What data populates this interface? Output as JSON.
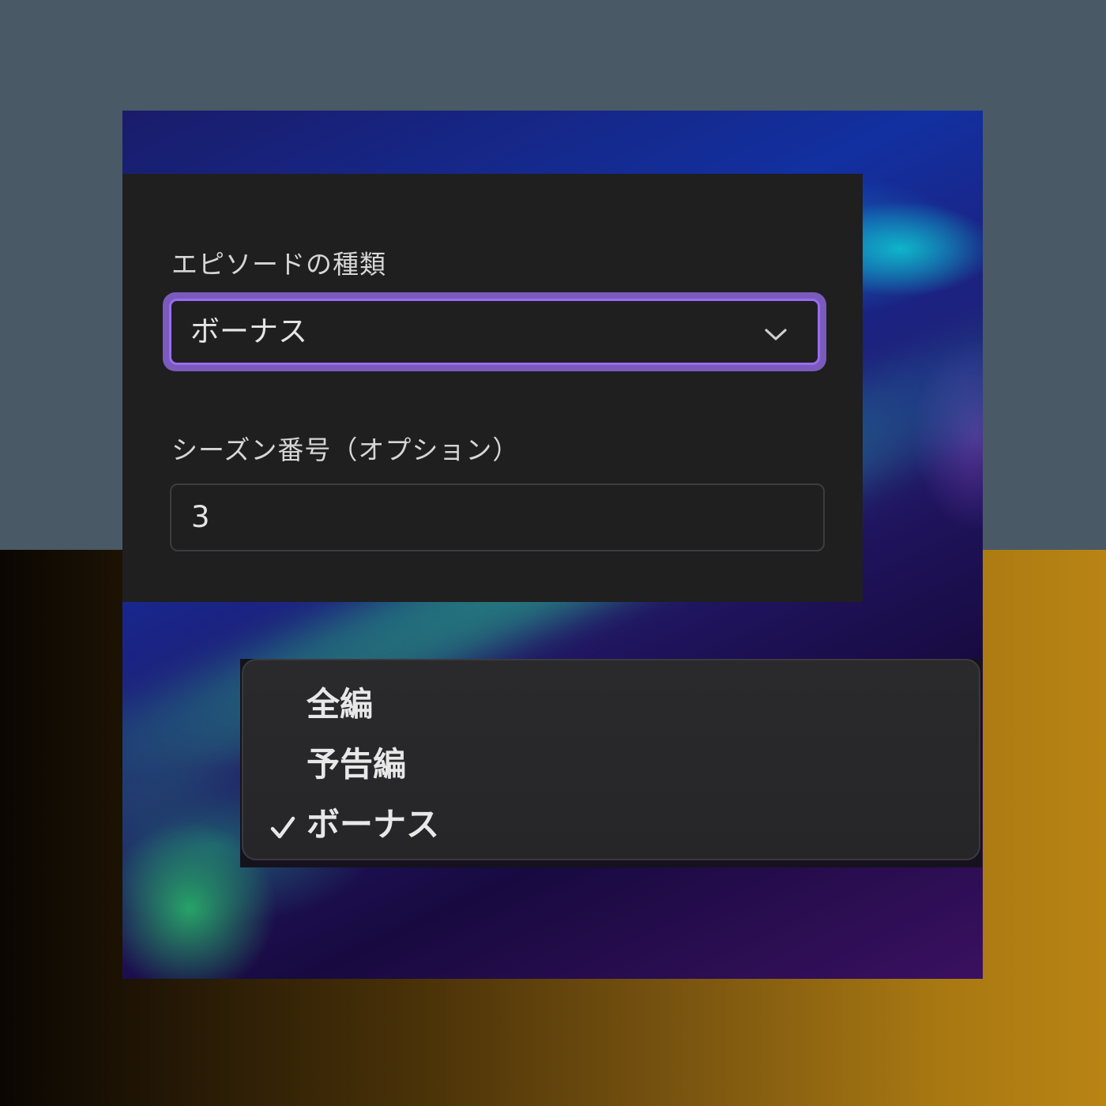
{
  "episode_type": {
    "label": "エピソードの種類",
    "selected_value": "ボーナス",
    "options": [
      "全編",
      "予告編",
      "ボーナス"
    ],
    "checked_option": "ボーナス"
  },
  "season_number": {
    "label": "シーズン番号（オプション）",
    "value": "3"
  },
  "icons": {
    "select_chevron": "chevron-down-icon",
    "selected_mark": "checkmark-icon"
  },
  "colors": {
    "focus_ring": "#9a6cf0",
    "panel_background": "#1f1f20",
    "menu_background": "#2a2a2c"
  }
}
